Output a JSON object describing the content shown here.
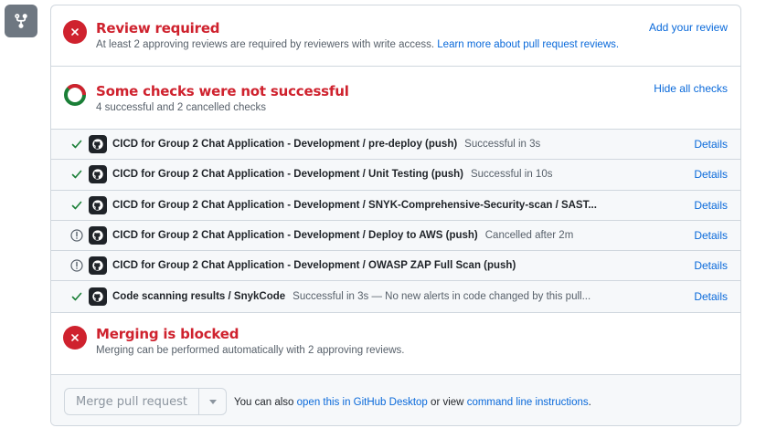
{
  "review": {
    "heading": "Review required",
    "subtext": "At least 2 approving reviews are required by reviewers with write access.",
    "learn_more": "Learn more about pull request reviews.",
    "action": "Add your review"
  },
  "checks": {
    "heading": "Some checks were not successful",
    "subtext": "4 successful and 2 cancelled checks",
    "action": "Hide all checks",
    "rows": [
      {
        "status": "success",
        "name": "CICD for Group 2 Chat Application - Development / pre-deploy (push)",
        "desc": "Successful in 3s",
        "details": "Details"
      },
      {
        "status": "success",
        "name": "CICD for Group 2 Chat Application - Development / Unit Testing (push)",
        "desc": "Successful in 10s",
        "details": "Details"
      },
      {
        "status": "success",
        "name": "CICD for Group 2 Chat Application - Development / SNYK-Comprehensive-Security-scan / SAST...",
        "desc": "",
        "details": "Details"
      },
      {
        "status": "cancelled",
        "name": "CICD for Group 2 Chat Application - Development / Deploy to AWS (push)",
        "desc": "Cancelled after 2m",
        "details": "Details"
      },
      {
        "status": "cancelled",
        "name": "CICD for Group 2 Chat Application - Development / OWASP ZAP Full Scan (push)",
        "desc": "",
        "details": "Details"
      },
      {
        "status": "success",
        "name": "Code scanning results / SnykCode",
        "desc": "Successful in 3s — No new alerts in code changed by this pull...",
        "details": "Details"
      }
    ]
  },
  "blocked": {
    "heading": "Merging is blocked",
    "subtext": "Merging can be performed automatically with 2 approving reviews."
  },
  "merge": {
    "button_label": "Merge pull request",
    "alt_prefix": "You can also",
    "desktop_link": "open this in GitHub Desktop",
    "alt_middle": "or view",
    "cli_link": "command line instructions",
    "alt_suffix": "."
  },
  "colors": {
    "danger": "#cf222e",
    "success": "#1a7f37",
    "link": "#0969da",
    "muted": "#57606a"
  }
}
